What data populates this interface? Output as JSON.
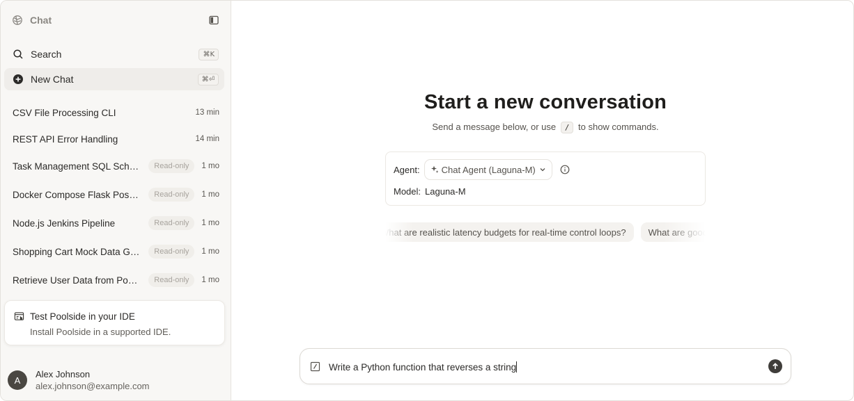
{
  "sidebar": {
    "title": "Chat",
    "search": {
      "label": "Search",
      "shortcut": "⌘K"
    },
    "new_chat": {
      "label": "New Chat",
      "shortcut": "⌘⏎"
    },
    "chats": [
      {
        "name": "CSV File Processing CLI",
        "badge": "",
        "time": "13 min"
      },
      {
        "name": "REST API Error Handling",
        "badge": "",
        "time": "14 min"
      },
      {
        "name": "Task Management SQL Schema",
        "badge": "Read-only",
        "time": "1 mo"
      },
      {
        "name": "Docker Compose Flask Postgres",
        "badge": "Read-only",
        "time": "1 mo"
      },
      {
        "name": "Node.js Jenkins Pipeline",
        "badge": "Read-only",
        "time": "1 mo"
      },
      {
        "name": "Shopping Cart Mock Data Generator",
        "badge": "Read-only",
        "time": "1 mo"
      },
      {
        "name": "Retrieve User Data from Postgres",
        "badge": "Read-only",
        "time": "1 mo"
      }
    ],
    "ide_card": {
      "title": "Test Poolside in your IDE",
      "subtitle": "Install Poolside in a supported IDE."
    },
    "user": {
      "initial": "A",
      "name": "Alex Johnson",
      "email": "alex.johnson@example.com"
    }
  },
  "main": {
    "title": "Start a new conversation",
    "subtitle_before": "Send a message below, or use",
    "subtitle_key": "/",
    "subtitle_after": "to show commands.",
    "agent_label": "Agent:",
    "agent_value": "Chat Agent (Laguna-M)",
    "model_label": "Model:",
    "model_value": "Laguna-M",
    "suggestions": [
      "What are realistic latency budgets for real-time control loops?",
      "What are good heuristics"
    ],
    "composer": {
      "value": "Write a Python function that reverses a string"
    }
  }
}
